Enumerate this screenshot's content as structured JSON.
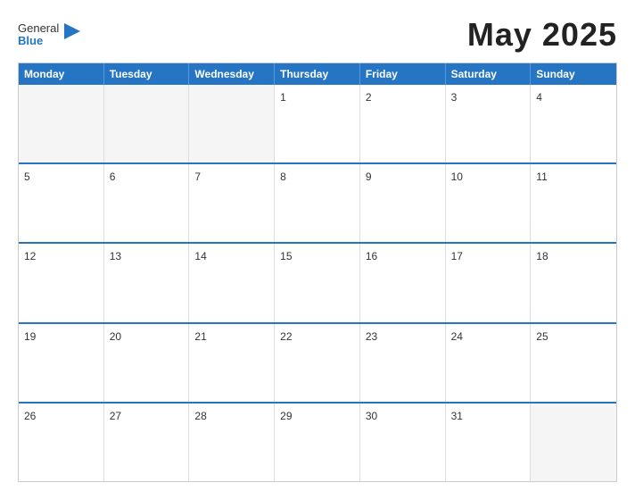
{
  "header": {
    "logo_general": "General",
    "logo_blue": "Blue",
    "title": "May 2025"
  },
  "calendar": {
    "days_of_week": [
      "Monday",
      "Tuesday",
      "Wednesday",
      "Thursday",
      "Friday",
      "Saturday",
      "Sunday"
    ],
    "weeks": [
      [
        {
          "date": "",
          "empty": true
        },
        {
          "date": "",
          "empty": true
        },
        {
          "date": "",
          "empty": true
        },
        {
          "date": "1",
          "empty": false
        },
        {
          "date": "2",
          "empty": false
        },
        {
          "date": "3",
          "empty": false
        },
        {
          "date": "4",
          "empty": false
        }
      ],
      [
        {
          "date": "5",
          "empty": false
        },
        {
          "date": "6",
          "empty": false
        },
        {
          "date": "7",
          "empty": false
        },
        {
          "date": "8",
          "empty": false
        },
        {
          "date": "9",
          "empty": false
        },
        {
          "date": "10",
          "empty": false
        },
        {
          "date": "11",
          "empty": false
        }
      ],
      [
        {
          "date": "12",
          "empty": false
        },
        {
          "date": "13",
          "empty": false
        },
        {
          "date": "14",
          "empty": false
        },
        {
          "date": "15",
          "empty": false
        },
        {
          "date": "16",
          "empty": false
        },
        {
          "date": "17",
          "empty": false
        },
        {
          "date": "18",
          "empty": false
        }
      ],
      [
        {
          "date": "19",
          "empty": false
        },
        {
          "date": "20",
          "empty": false
        },
        {
          "date": "21",
          "empty": false
        },
        {
          "date": "22",
          "empty": false
        },
        {
          "date": "23",
          "empty": false
        },
        {
          "date": "24",
          "empty": false
        },
        {
          "date": "25",
          "empty": false
        }
      ],
      [
        {
          "date": "26",
          "empty": false
        },
        {
          "date": "27",
          "empty": false
        },
        {
          "date": "28",
          "empty": false
        },
        {
          "date": "29",
          "empty": false
        },
        {
          "date": "30",
          "empty": false
        },
        {
          "date": "31",
          "empty": false
        },
        {
          "date": "",
          "empty": true
        }
      ]
    ]
  }
}
